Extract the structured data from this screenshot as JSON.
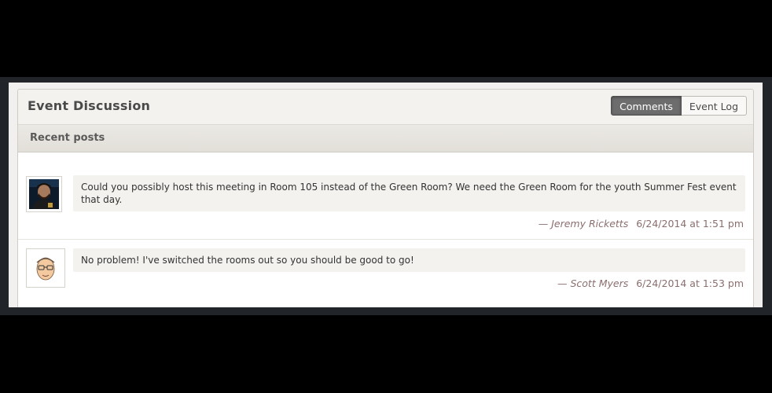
{
  "panel": {
    "title": "Event Discussion",
    "tabs": [
      {
        "label": "Comments",
        "active": true
      },
      {
        "label": "Event Log",
        "active": false
      }
    ],
    "subheading": "Recent posts"
  },
  "posts": [
    {
      "text": "Could you possibly host this meeting in Room 105 instead of the Green Room? We need the Green Room for the youth Summer Fest event that day.",
      "author": "— Jeremy Ricketts",
      "datetime": "6/24/2014 at 1:51 pm",
      "avatar_icon": "person-photo-avatar"
    },
    {
      "text": "No problem! I've switched the rooms out so you should be good to go!",
      "author": "— Scott Myers",
      "datetime": "6/24/2014 at 1:53 pm",
      "avatar_icon": "cartoon-face-avatar"
    }
  ],
  "colors": {
    "active_tab_bg": "#6d6d6d",
    "meta_text": "#8b6e6e"
  }
}
